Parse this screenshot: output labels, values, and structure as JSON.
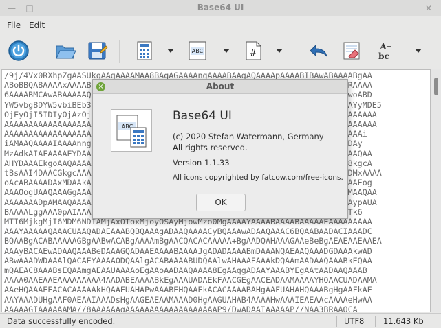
{
  "window": {
    "title": "Base64 UI"
  },
  "titlebar": {
    "minimize_glyph": "—",
    "maximize_glyph": "□",
    "close_glyph": "✕"
  },
  "menu": {
    "file": "File",
    "edit": "Edit"
  },
  "toolbar": {
    "icons": [
      "power-icon",
      "open-folder-icon",
      "save-icon",
      "encode-calc-icon",
      "abc-format-icon",
      "hash-document-icon",
      "undo-icon",
      "clear-eraser-icon",
      "spell-check-icon"
    ],
    "dropdown_glyph": "▼"
  },
  "editor": {
    "lines": [
      "/9j/4Vx0RXhpZgAASUkqAAgAAAAMAA8BAgAGAAAAngAAAABAAgAQAAAApAAAABIBAwABAAAABgAA",
      "ABoBBQABAAAAxAAAABsBBQABAAAAzAAAACgBAwABAAAAAgAAADEBAgAUAAAA1AAAADsBAgARAAAA",
      "6AAAABMCAwABAAAAAQAAAGmHBAABAAAAGgEAACKIAwABAAAAAgAAAIWQBAABAAAAAKiEAACwoABD",
      "YW5vbgBDYW5vbiBEb3MgRU9TIDVEAAAAAEgAAAABAAAASAAAAAEAAAAAAAAAAAAAAAAAAAAAYyMDE5",
      "OjEyOjI5IDIyOjAzOjQ0AAAAAAAAAAAAAAAAAAAAAAAAAAAAAAAAAAAAAAAAAAAAAAAAAAAAAAAAA",
      "AAAAAAAAAAAAAAAAAAAAAAAAAAAAAAAAAAAAAAAAAAAAAAAAAAAAAAAAAAAAAAAAAAAAAAAAAAAAA",
      "AAAAAAAAAAAAAAAAAAAAAAAAAAAAAAAAAAAAAAAAAAAAAAAAAAAAAAAAAAAAAAUAAQAAD4DAAAi",
      "iAMAAQAAAAIAAAAnngMAAQAAAIAAAAAAkAcABAAAADAyMzCQAwACAAAAAFgAAAkAcABAAAADAy",
      "MzAdkAIAFAAAAEYDAAKQAgAUAAAAWgMAAAGRBwAEAAAAAQIDAAKSAwABAAAAAAIDAAACkgUAAQAA",
      "AHYDAAAEkgoAAQAAAAAAAAAIkAMAAQAAAAAAAAAEkAMAAQAAAAEAAAAKkgUAAQAAAIYDAAB8kgcA",
      "tBsAAI4DAACGkgcAAAAAAAAAAAAAAAAAAAAAAAAAAAAAAAAAAAAAAAAAAAAAAAAAAAAwAAADMxAAAA",
      "oAcABAAAADAxMDAAkAcABAAAADAwMDAAkAcABAAAADAwMDABAAAAAAAAAAAAAAAFoAQAAQAAAEog",
      "AAAOogUAAQAAAGgAAAAAAAAAAAAAAAAAAAAAAAAAAAAAAAAAAAAAAAAAAAAAAAAAAAAACpAMAAQAA",
      "AAAAAAADpAMAAQAAAAAAAAAAAAAAAAAAAAAAAAAAAAAAAAAAAAAAAAAAAAAAAAAAAAJggAAAypAUA",
      "BAAAALggAAA0pAIAAAAAAAAAAAAAAAAAAAAAAAAAAAAAAAAAAAAAAAAAAAAAAAAAAAAAIwMTk6",
      "MTI6MjkgMjI6MDM6NDIAMjAxOToxMjoyOSAyMjowMzo0MgAAAAYAAAABAAAABAAAAAEAAAAAAAAA",
      "AAAYAAAAAQAAACUAAQADAEAAABQBQAAAgADAAQAAAACyBQAAAwADAAQAAAC6BQAABAADACIAAADC",
      "BQAABgACABAAAAAGBgAABwACABgAAAAmBgAACQACACAAAAA+BgAADQAHAAAGAAeBeBgAEAEAAEAAEA",
      "AAAyBACAEwADAAQAAABeDAAAGQADAAEAAAABAAAAJgADADAAAABmDAAANQAEAAQAAADGDAAAkwAD",
      "ABwAAADWDAAAlQACAEYAAAAODQAAlgACABAAAABUDQAAlwAHAAAEAAAkDQAAmAADAAQAAABkEQAA",
      "mQAEAC8AAABsEQAAmgAEAAUAAAAoEgAAoAADAAQAAAA8EgAAqgADAAYAAABYEgAAtAADAAQAAAB",
      "AAAA0AAEAAEAAAAAAAAA4AADABEAAAABkEgAAAUADAEkFAACGEgAACEADAAMAAAAYHQAACUADAAMA",
      "AAeHQAAAEEACACAAAAAkHQAAEUAHAPwAAABEHQAAEkACACAAAABAHgAAFUAHAHQAAABgHgAAFkAE",
      "AAYAAADUHgAAF0AEAAIAAADsHgAAGEAEAAMAAAD0HgAAGUAHAB4AAAAHwAAAIEAEAAcAAAAeHwAA",
      "AAAAAGIAAAAAAMA//8AAAAAAgAAAAAAAAAAAAAAAAAAAP9/DwADAAIAAAAAP//NAA3BRAAOCA"
    ]
  },
  "status": {
    "message": "Data successfully encoded.",
    "encoding": "UTF8",
    "size": "11.643 Kb"
  },
  "about_dialog": {
    "title": "About",
    "close_glyph": "×",
    "app_name": "Base64 UI",
    "copyright": "(c) 2020 Stefan Watermann, Germany",
    "rights": "All rights reserved.",
    "version": "Version 1.1.33",
    "icons_credit": "All icons copyrighted by fatcow.com/free-icons.",
    "ok_label": "OK"
  }
}
